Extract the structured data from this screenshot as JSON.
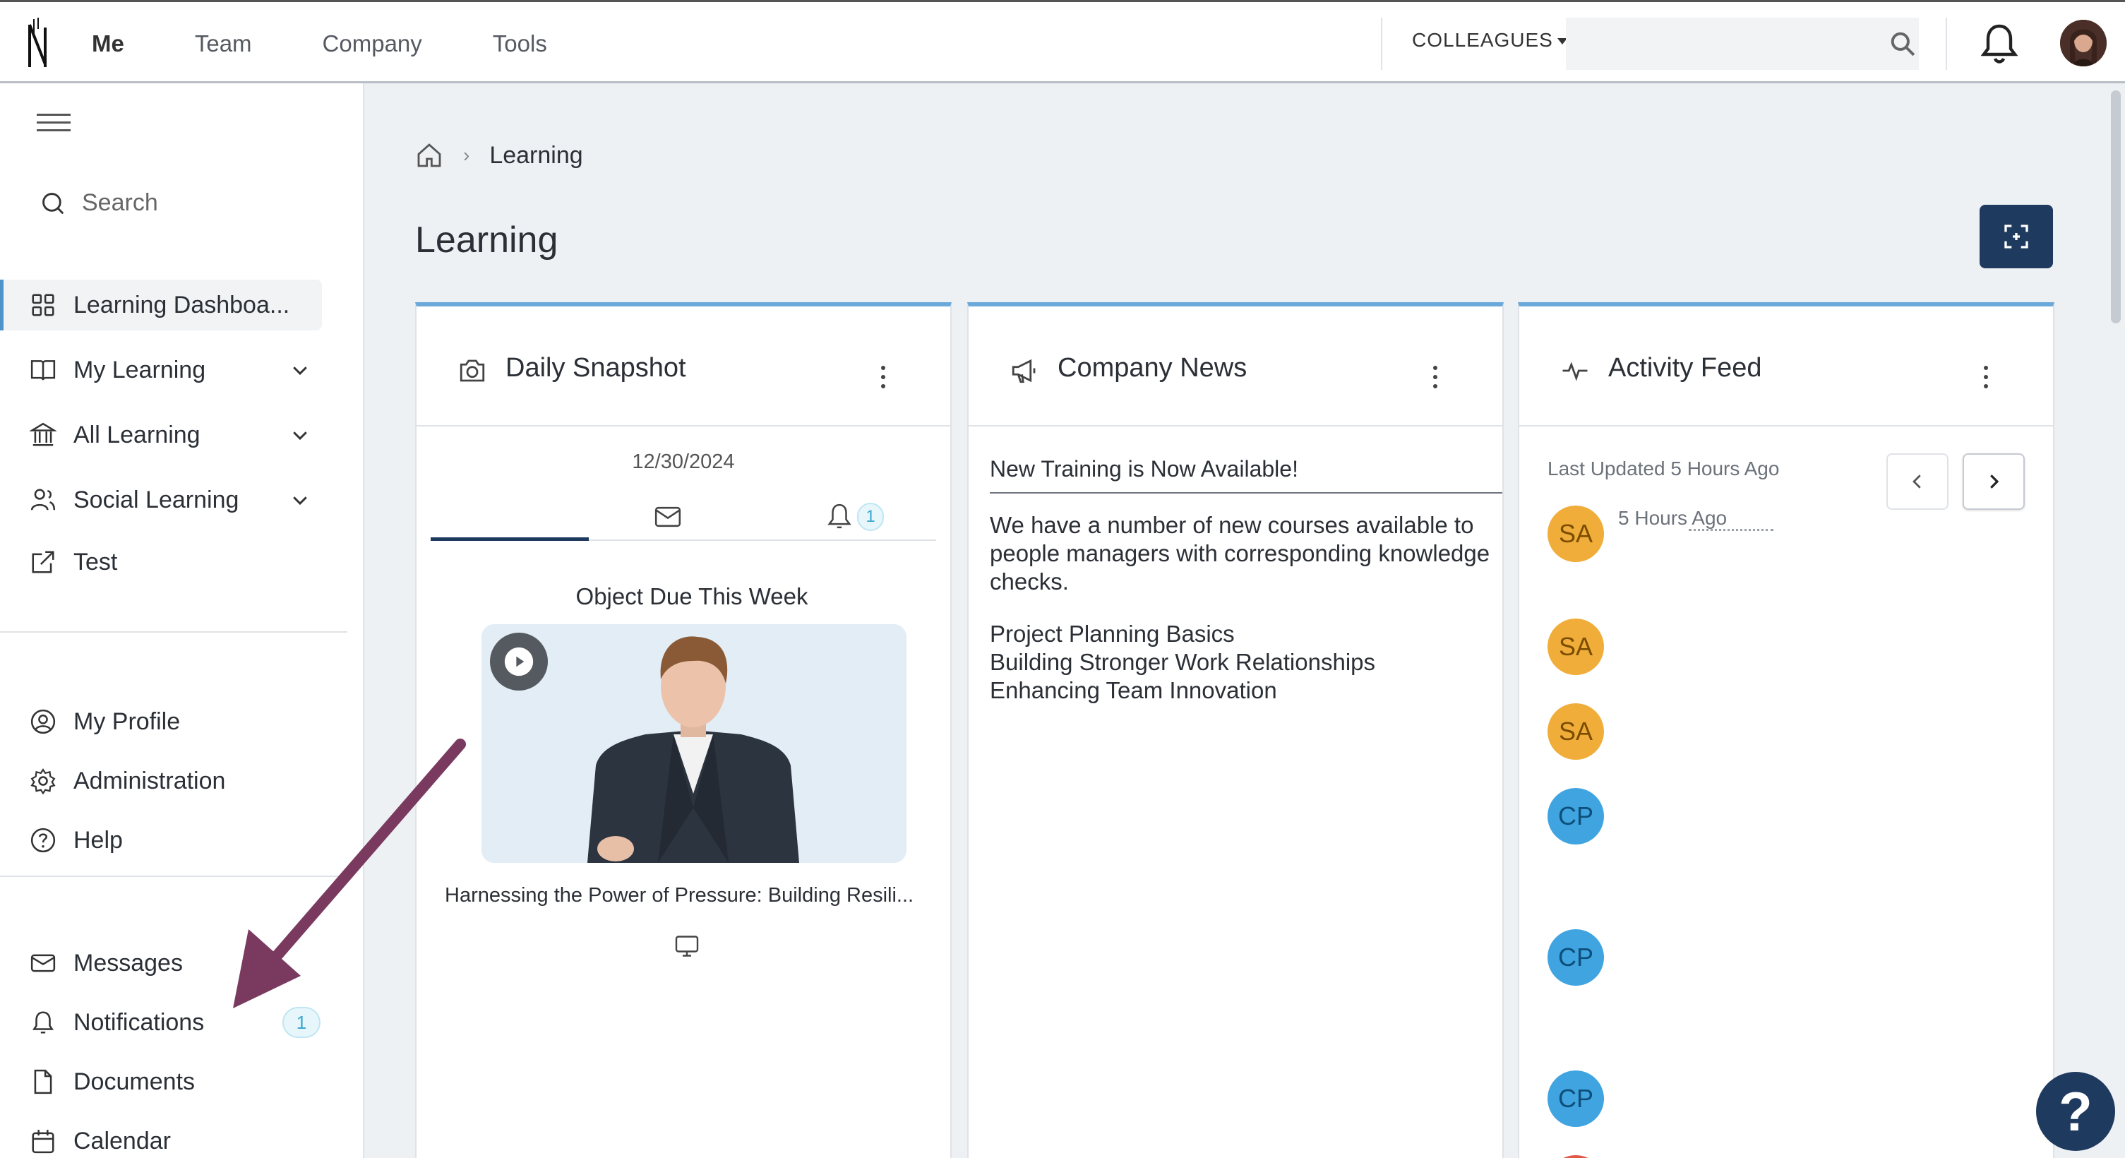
{
  "topbar": {
    "nav": [
      "Me",
      "Team",
      "Company",
      "Tools"
    ],
    "colleagues_label": "COLLEAGUES",
    "search_value": "",
    "icons": {
      "search": "search-icon",
      "bell": "bell-icon",
      "avatar": "user-avatar"
    }
  },
  "sidebar": {
    "search_label": "Search",
    "primary": [
      {
        "label": "Learning Dashboa...",
        "icon": "grid-icon",
        "active": true
      },
      {
        "label": "My Learning",
        "icon": "book-icon",
        "expandable": true
      },
      {
        "label": "All Learning",
        "icon": "library-icon",
        "expandable": true
      },
      {
        "label": "Social Learning",
        "icon": "people-icon",
        "expandable": true
      },
      {
        "label": "Test",
        "icon": "external-link-icon"
      }
    ],
    "secondary": [
      {
        "label": "My Profile",
        "icon": "profile-icon"
      },
      {
        "label": "Administration",
        "icon": "gear-icon"
      },
      {
        "label": "Help",
        "icon": "question-icon"
      }
    ],
    "tertiary": [
      {
        "label": "Messages",
        "icon": "mail-icon"
      },
      {
        "label": "Notifications",
        "icon": "bell-icon",
        "badge": "1"
      },
      {
        "label": "Documents",
        "icon": "document-icon"
      },
      {
        "label": "Calendar",
        "icon": "calendar-icon"
      }
    ]
  },
  "breadcrumb": {
    "current": "Learning"
  },
  "page": {
    "title": "Learning"
  },
  "cards": {
    "snapshot": {
      "title": "Daily Snapshot",
      "date": "12/30/2024",
      "notif_badge": "1",
      "due_title": "Object Due This Week",
      "video_caption": "Harnessing the Power of Pressure: Building Resili..."
    },
    "news": {
      "title": "Company News",
      "headline": "New Training is Now Available!",
      "body": "We have a number of new courses available to people managers with corresponding knowledge checks.",
      "courses": [
        "Project Planning Basics",
        "Building Stronger Work Relationships",
        "Enhancing Team Innovation"
      ]
    },
    "feed": {
      "title": "Activity Feed",
      "updated": "Last Updated 5 Hours Ago",
      "first_time": "5 Hours Ago",
      "avatars": [
        "SA",
        "SA",
        "SA",
        "CP",
        "CP",
        "CP"
      ]
    }
  },
  "help_label": "?",
  "colors": {
    "navy": "#1f3a5f",
    "accent": "#6aa9d9",
    "arrow": "#7a3a60",
    "sa": "#f0ad3a",
    "cp": "#3fa4e0"
  }
}
